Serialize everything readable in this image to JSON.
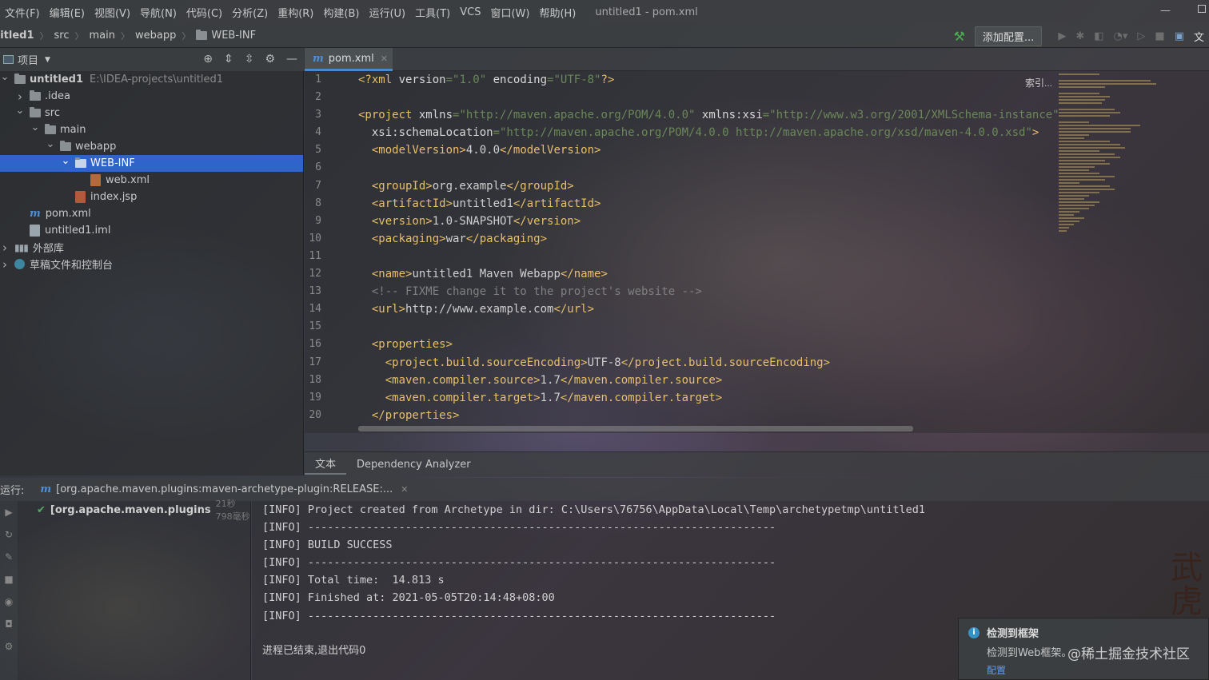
{
  "menubar": {
    "items": [
      "文件(F)",
      "编辑(E)",
      "视图(V)",
      "导航(N)",
      "代码(C)",
      "分析(Z)",
      "重构(R)",
      "构建(B)",
      "运行(U)",
      "工具(T)",
      "VCS",
      "窗口(W)",
      "帮助(H)"
    ],
    "window_title": "untitled1 - pom.xml"
  },
  "navbar": {
    "breadcrumbs": [
      "titled1",
      "src",
      "main",
      "webapp",
      "WEB-INF"
    ],
    "add_config_label": "添加配置...",
    "tab_label_right": "文"
  },
  "project_panel": {
    "title": "项目",
    "tree": [
      {
        "label": "untitled1",
        "hint": "E:\\IDEA-projects\\untitled1",
        "level": 0,
        "arrow": "down",
        "icon": "module-folder-icon"
      },
      {
        "label": ".idea",
        "level": 1,
        "arrow": "right",
        "icon": "folder-icon"
      },
      {
        "label": "src",
        "level": 1,
        "arrow": "down",
        "icon": "folder-icon"
      },
      {
        "label": "main",
        "level": 2,
        "arrow": "down",
        "icon": "folder-icon"
      },
      {
        "label": "webapp",
        "level": 3,
        "arrow": "down",
        "icon": "folder-icon"
      },
      {
        "label": "WEB-INF",
        "level": 4,
        "arrow": "down",
        "icon": "folder-icon",
        "selected": true
      },
      {
        "label": "web.xml",
        "level": 5,
        "arrow": "",
        "icon": "xml-file-icon"
      },
      {
        "label": "index.jsp",
        "level": 4,
        "arrow": "",
        "icon": "jsp-file-icon"
      },
      {
        "label": "pom.xml",
        "level": 1,
        "arrow": "",
        "icon": "maven-icon"
      },
      {
        "label": "untitled1.iml",
        "level": 1,
        "arrow": "",
        "icon": "iml-file-icon"
      },
      {
        "label": "外部库",
        "level": 0,
        "arrow": "right",
        "icon": "library-icon"
      },
      {
        "label": "草稿文件和控制台",
        "level": 0,
        "arrow": "right",
        "icon": "scratch-icon"
      }
    ]
  },
  "editor": {
    "tab_label": "pom.xml",
    "index_hint": "索引...",
    "line_numbers": [
      "1",
      "2",
      "3",
      "4",
      "5",
      "6",
      "7",
      "8",
      "9",
      "10",
      "11",
      "12",
      "13",
      "14",
      "15",
      "16",
      "17",
      "18",
      "19",
      "20"
    ],
    "bottom_tabs": [
      "文本",
      "Dependency Analyzer"
    ]
  },
  "run_panel": {
    "label": "运行:",
    "tab_label": "[org.apache.maven.plugins:maven-archetype-plugin:RELEASE:...",
    "tree_item": "[org.apache.maven.plugins",
    "tree_item_time": "21秒798毫秒",
    "console_lines": [
      "[INFO] Project created from Archetype in dir: C:\\Users\\76756\\AppData\\Local\\Temp\\archetypetmp\\untitled1",
      "[INFO] ------------------------------------------------------------------------",
      "[INFO] BUILD SUCCESS",
      "[INFO] ------------------------------------------------------------------------",
      "[INFO] Total time:  14.813 s",
      "[INFO] Finished at: 2021-05-05T20:14:48+08:00",
      "[INFO] ------------------------------------------------------------------------",
      "",
      "进程已结束,退出代码0"
    ]
  },
  "notification": {
    "title": "检测到框架",
    "body": "检测到Web框架。",
    "link": "配置"
  },
  "watermark": "@稀土掘金技术社区",
  "bg_glyph": "武虎"
}
